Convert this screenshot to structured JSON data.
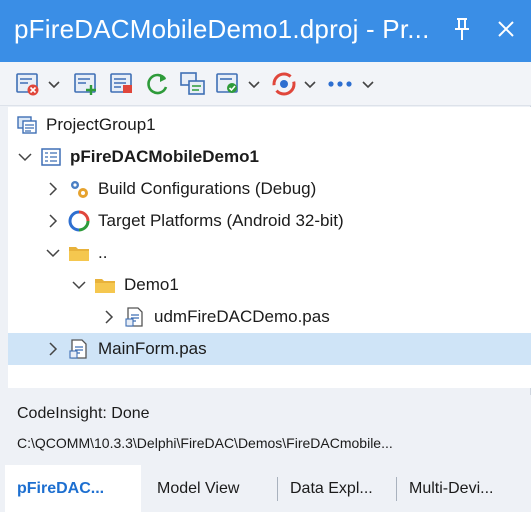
{
  "window": {
    "title": "pFireDACMobileDemo1.dproj - Pr...",
    "pin_icon": "pin-icon",
    "close_icon": "close-icon"
  },
  "toolbar": {
    "buttons": [
      {
        "name": "remove-file-icon"
      },
      {
        "name": "dropdown-chevron-icon"
      },
      {
        "name": "add-file-icon"
      },
      {
        "name": "view-file-icon"
      },
      {
        "name": "refresh-icon"
      },
      {
        "name": "build-icon"
      },
      {
        "name": "compile-icon"
      },
      {
        "name": "dropdown-chevron-icon"
      },
      {
        "name": "target-icon"
      },
      {
        "name": "dropdown-chevron-icon"
      },
      {
        "name": "more-icon"
      },
      {
        "name": "dropdown-chevron-icon"
      }
    ]
  },
  "tree": {
    "items": [
      {
        "label": "ProjectGroup1",
        "bold": false
      },
      {
        "label": "pFireDACMobileDemo1",
        "bold": true
      },
      {
        "label": "Build Configurations (Debug)",
        "bold": false
      },
      {
        "label": "Target Platforms (Android 32-bit)",
        "bold": false
      },
      {
        "label": "..",
        "bold": false
      },
      {
        "label": "Demo1",
        "bold": false
      },
      {
        "label": "udmFireDACDemo.pas",
        "bold": false
      },
      {
        "label": "MainForm.pas",
        "bold": false,
        "selected": true
      }
    ]
  },
  "status": {
    "line1": "CodeInsight: Done",
    "line2": "C:\\QCOMM\\10.3.3\\Delphi\\FireDAC\\Demos\\FireDACmobile..."
  },
  "tabs": [
    {
      "label": "pFireDAC...",
      "active": true
    },
    {
      "label": "Model View",
      "active": false
    },
    {
      "label": "Data Expl...",
      "active": false
    },
    {
      "label": "Multi-Devi...",
      "active": false
    }
  ],
  "colors": {
    "titlebar": "#3a8ee6",
    "selection": "#cfe4f7",
    "active_tab_text": "#1d6fd0"
  }
}
